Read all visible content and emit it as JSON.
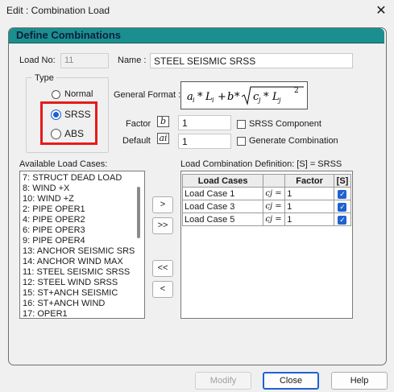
{
  "window": {
    "title": "Edit : Combination Load",
    "close_glyph": "✕"
  },
  "panel": {
    "title": "Define Combinations"
  },
  "load_no": {
    "label": "Load No:",
    "value": "11"
  },
  "name": {
    "label": "Name :",
    "value": "STEEL SEISMIC SRSS"
  },
  "type_group": {
    "label": "Type",
    "options": [
      "Normal",
      "SRSS",
      "ABS"
    ],
    "selected": "SRSS"
  },
  "general_format": {
    "label": "General Format :"
  },
  "factor": {
    "label": "Factor",
    "symbol": "b",
    "value": "1"
  },
  "default": {
    "label": "Default",
    "symbol": "ai",
    "value": "1"
  },
  "checks": {
    "srss_component": "SRSS Component",
    "generate_combination": "Generate Combination"
  },
  "available": {
    "label": "Available Load Cases:",
    "items": [
      "7: STRUCT DEAD LOAD",
      "8: WIND +X",
      "10: WIND +Z",
      "2: PIPE OPER1",
      "4: PIPE OPER2",
      "6: PIPE OPER3",
      "9: PIPE OPER4",
      "13: ANCHOR SEISMIC SRS",
      "14: ANCHOR WIND MAX",
      "11: STEEL SEISMIC SRSS",
      "12: STEEL WIND SRSS",
      "15: ST+ANCH SEISMIC",
      "16: ST+ANCH WIND",
      "17: OPER1"
    ]
  },
  "transfer_buttons": {
    "add": ">",
    "add_all": ">>",
    "remove_all": "<<",
    "remove": "<"
  },
  "definition": {
    "label": "Load Combination Definition:  [S] = SRSS",
    "headers": {
      "load_cases": "Load Cases",
      "factor": "Factor",
      "s": "[S]"
    },
    "coef": "cj =",
    "rows": [
      {
        "case": "Load Case 1",
        "factor": "1",
        "s": true
      },
      {
        "case": "Load Case 3",
        "factor": "1",
        "s": true
      },
      {
        "case": "Load Case 5",
        "factor": "1",
        "s": true
      }
    ]
  },
  "footer": {
    "modify": "Modify",
    "close": "Close",
    "help": "Help"
  },
  "colors": {
    "panel_header": "#1b8f8f",
    "highlight": "#e51b1b",
    "accent": "#1e62d0"
  }
}
